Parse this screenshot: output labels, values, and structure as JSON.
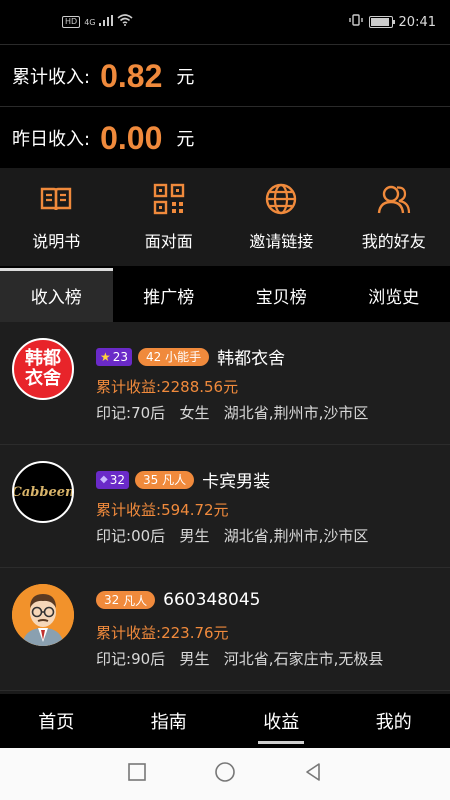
{
  "status_bar": {
    "hd": "HD",
    "network": "4G",
    "time": "20:41"
  },
  "income": {
    "total_label": "累计收入:",
    "total_value": "0.82",
    "total_unit": "元",
    "yesterday_label": "昨日收入:",
    "yesterday_value": "0.00",
    "yesterday_unit": "元"
  },
  "quick_menu": [
    {
      "label": "说明书",
      "icon": "book-icon"
    },
    {
      "label": "面对面",
      "icon": "qrcode-icon"
    },
    {
      "label": "邀请链接",
      "icon": "globe-icon"
    },
    {
      "label": "我的好友",
      "icon": "friends-icon"
    }
  ],
  "tabs": [
    "收入榜",
    "推广榜",
    "宝贝榜",
    "浏览史"
  ],
  "users": [
    {
      "avatar_text": [
        "韩都",
        "衣舍"
      ],
      "star": "23",
      "level_num": "42",
      "level_title": "小能手",
      "name": "韩都衣舍",
      "earn_label": "累计收益:",
      "earn_value": "2288.56元",
      "tag_label": "印记:",
      "age": "70后",
      "gender": "女生",
      "location": "湖北省,荆州市,沙市区"
    },
    {
      "avatar_text": "Cabbeen",
      "star": "32",
      "level_num": "35",
      "level_title": "凡人",
      "name": "卡宾男装",
      "earn_label": "累计收益:",
      "earn_value": "594.72元",
      "tag_label": "印记:",
      "age": "00后",
      "gender": "男生",
      "location": "湖北省,荆州市,沙市区"
    },
    {
      "level_num": "32",
      "level_title": "凡人",
      "name": "660348045",
      "earn_label": "累计收益:",
      "earn_value": "223.76元",
      "tag_label": "印记:",
      "age": "90后",
      "gender": "男生",
      "location": "河北省,石家庄市,无极县"
    }
  ],
  "bottom_nav": [
    "首页",
    "指南",
    "收益",
    "我的"
  ],
  "colors": {
    "accent": "#f08a3c",
    "star_badge": "#6a2ac8",
    "background": "#000000"
  }
}
